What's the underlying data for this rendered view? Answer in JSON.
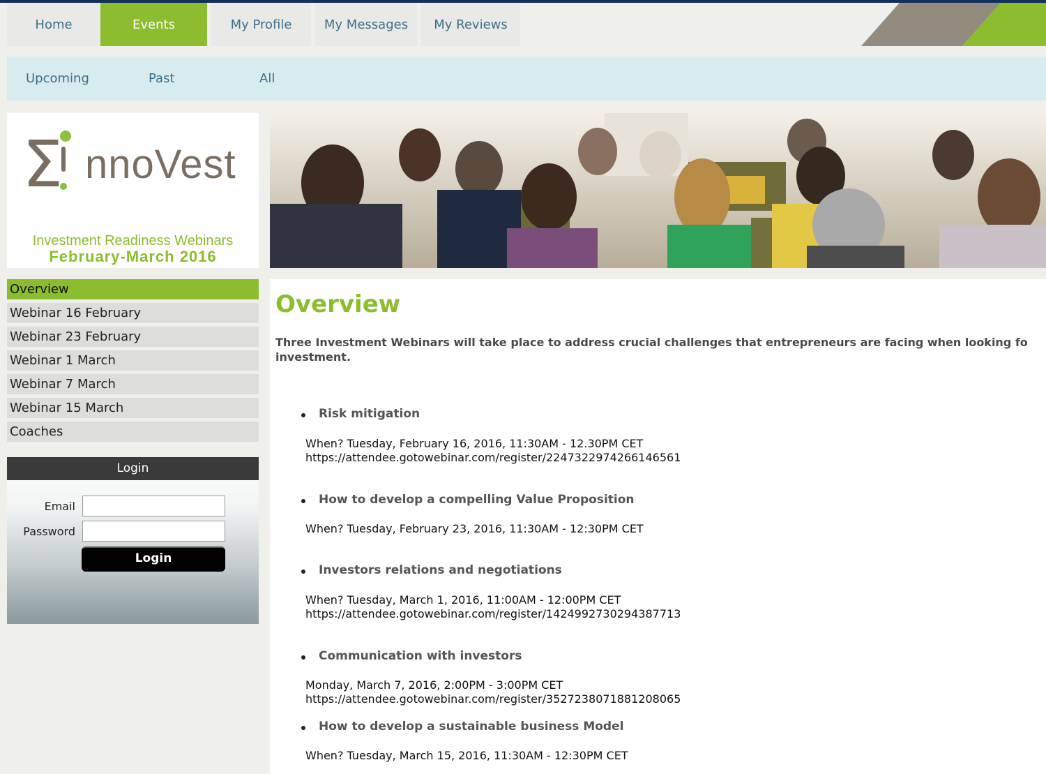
{
  "topnav": {
    "tabs": [
      {
        "label": "Home"
      },
      {
        "label": "Events"
      },
      {
        "label": "My Profile"
      },
      {
        "label": "My Messages"
      },
      {
        "label": "My Reviews"
      }
    ]
  },
  "subnav": {
    "items": [
      {
        "label": "Upcoming"
      },
      {
        "label": "Past"
      },
      {
        "label": "All"
      }
    ]
  },
  "logo": {
    "sigma": "Σ",
    "word": "nnoVest",
    "tagline": "Investment Readiness Webinars",
    "dates": "February-March 2016"
  },
  "sidemenu": {
    "items": [
      {
        "label": "Overview"
      },
      {
        "label": "Webinar 16 February"
      },
      {
        "label": "Webinar 23 February"
      },
      {
        "label": "Webinar 1 March"
      },
      {
        "label": "Webinar 7 March"
      },
      {
        "label": "Webinar 15 March"
      },
      {
        "label": "Coaches"
      }
    ]
  },
  "login": {
    "heading": "Login",
    "email_label": "Email",
    "password_label": "Password",
    "button_label": "Login"
  },
  "main": {
    "title": "Overview",
    "intro": "Three Investment Webinars will take place to address crucial challenges that entrepreneurs are facing when looking fo investment.",
    "webinars": [
      {
        "title": "Risk mitigation",
        "when": "When? Tuesday, February 16, 2016, 11:30AM - 12.30PM CET",
        "link": "https://attendee.gotowebinar.com/register/2247322974266146561"
      },
      {
        "title": "How to develop a compelling Value Proposition",
        "when": "When? Tuesday, February 23, 2016, 11:30AM - 12:30PM CET",
        "link": ""
      },
      {
        "title": "Investors relations and negotiations",
        "when": "When? Tuesday, March 1, 2016, 11:00AM - 12:00PM CET",
        "link": "https://attendee.gotowebinar.com/register/1424992730294387713"
      },
      {
        "title": "Communication with investors",
        "when": "Monday, March 7, 2016, 2:00PM - 3:00PM CET",
        "link": "https://attendee.gotowebinar.com/register/3527238071881208065"
      },
      {
        "title": "How to develop a sustainable business Model",
        "when": "When? Tuesday, March 15, 2016, 11:30AM - 12:30PM CET",
        "link": ""
      }
    ]
  },
  "colors": {
    "accent_green": "#8bbd2e",
    "link_blue": "#3d6f88",
    "frame_navy": "#12305a"
  }
}
